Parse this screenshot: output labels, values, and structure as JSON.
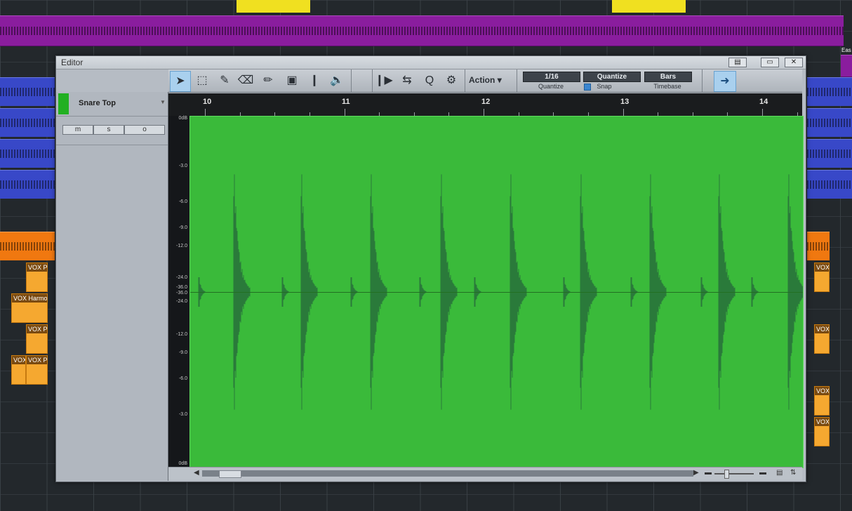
{
  "editor": {
    "title": "Editor"
  },
  "toolbar": {
    "tools": [
      "arrow-icon",
      "range-icon",
      "split-icon",
      "eraser-icon",
      "paint-icon",
      "mute-icon",
      "bend-icon",
      "listen-icon",
      "transient-icon",
      "bend-marker-icon",
      "quantize-icon",
      "audio-bend-icon"
    ],
    "action_label": "Action",
    "quantize_value": "1/16",
    "quantize_label": "Quantize",
    "snap_value": "Quantize",
    "snap_label": "Snap",
    "timebase_value": "Bars",
    "timebase_label": "Timebase"
  },
  "track": {
    "name": "Snare Top",
    "color": "#22b022",
    "m": "m",
    "s": "s",
    "o": "o"
  },
  "ruler": {
    "bars": [
      "10",
      "11",
      "12",
      "13",
      "14"
    ]
  },
  "db_scale": {
    "top": "0dB",
    "labels": [
      "-3.0",
      "-6.0",
      "-9.0",
      "-12.0",
      "-24.0",
      "-36.0",
      "-36.0",
      "-24.0",
      "-12.0",
      "-9.0",
      "-6.0",
      "-3.0"
    ],
    "bottom": "0dB"
  },
  "arranger": {
    "clips": [
      "VOX P",
      "VOX Harmo",
      "VOX P",
      "VOX",
      "VOX P",
      "VOX",
      "VOX",
      "VOX",
      "VOX",
      "Eas"
    ]
  },
  "colors": {
    "waveform_bg": "#3aba3a",
    "waveform": "#2a7a3a",
    "accent": "#a9d0ee"
  }
}
